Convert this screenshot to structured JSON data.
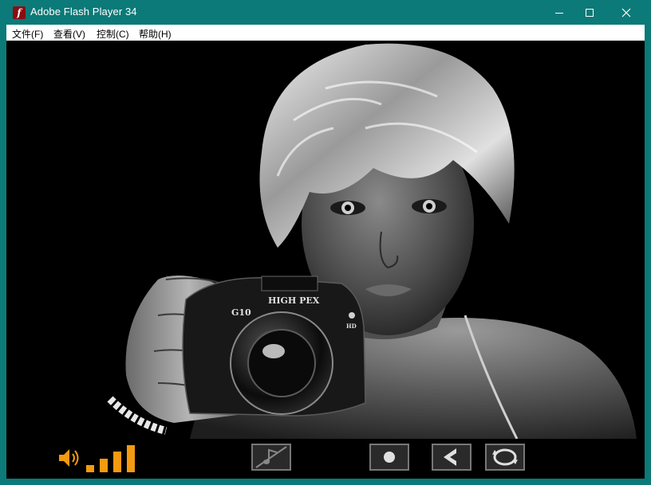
{
  "window": {
    "title": "Adobe Flash Player 34",
    "icon": "flash-player-icon",
    "controls": [
      "minimize-icon",
      "maximize-icon",
      "close-icon"
    ]
  },
  "menu": {
    "items": [
      {
        "label": "文件(F)"
      },
      {
        "label": "查看(V)"
      },
      {
        "label": "控制(C)"
      },
      {
        "label": "帮助(H)"
      }
    ]
  },
  "content": {
    "scene": "portrait-photographer",
    "camera_labels": {
      "model": "G10",
      "brand": "HIGH PEX",
      "badge": "HD"
    }
  },
  "player_controls": {
    "accent_color": "#f39a10",
    "inactive_color": "#777777",
    "volume_level": 4,
    "volume_max": 4,
    "buttons": [
      {
        "icon": "help-icon",
        "active": true
      },
      {
        "icon": "music-off-icon",
        "active": false
      },
      {
        "icon": "fast-forward-icon",
        "active": true
      },
      {
        "icon": "record-icon",
        "active": false
      },
      {
        "icon": "previous-icon",
        "active": false
      },
      {
        "icon": "loop-icon",
        "active": false
      },
      {
        "icon": "next-icon",
        "active": true
      }
    ]
  }
}
